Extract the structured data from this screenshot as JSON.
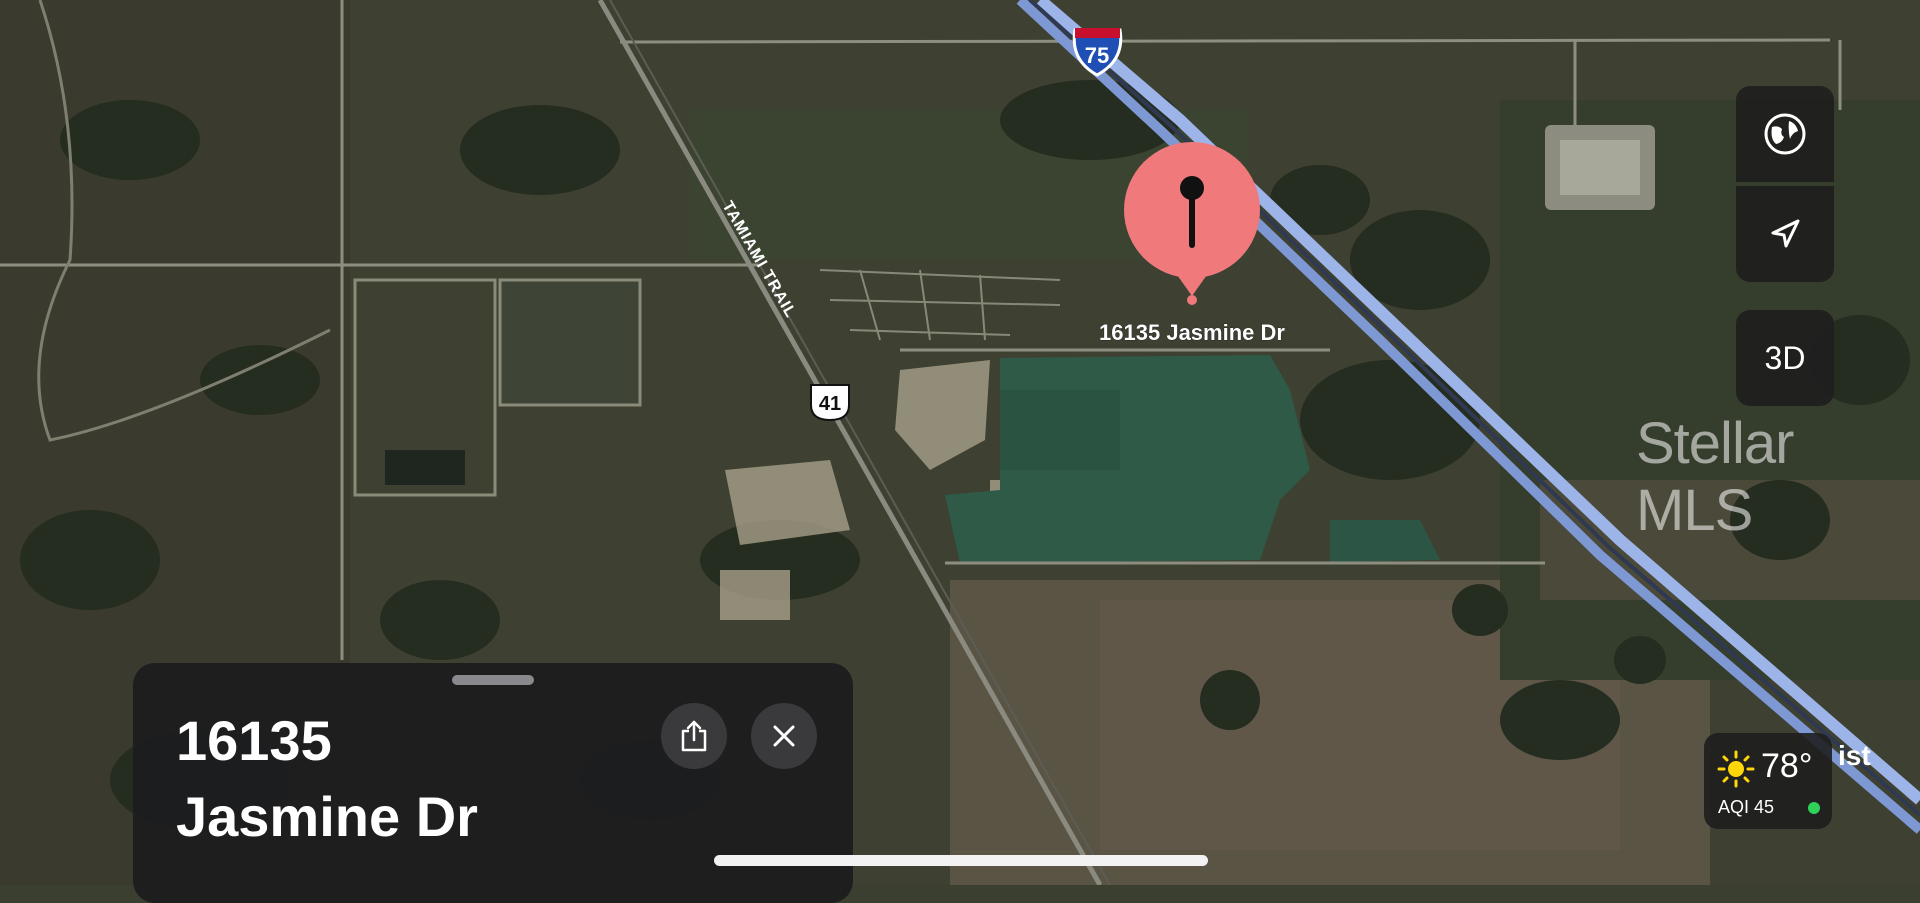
{
  "map": {
    "type": "satellite",
    "road_labels": {
      "tamiami": "TAMIAMI TRAIL",
      "interstate_shield": "75",
      "us_route_shield": "41"
    },
    "pin": {
      "label": "16135 Jasmine Dr",
      "color": "#f0797c"
    },
    "watermark": "Stellar MLS",
    "partial_label": "ist"
  },
  "place_card": {
    "title_line1": "16135",
    "title_line2": "Jasmine Dr",
    "share_icon": "share-icon",
    "close_icon": "close-icon"
  },
  "controls": {
    "globe_icon": "globe-icon",
    "location_icon": "location-arrow-icon",
    "view_3d_label": "3D"
  },
  "weather": {
    "temperature": "78°",
    "aqi": "AQI 45",
    "aqi_status_color": "#30d158",
    "icon": "sun-icon"
  }
}
